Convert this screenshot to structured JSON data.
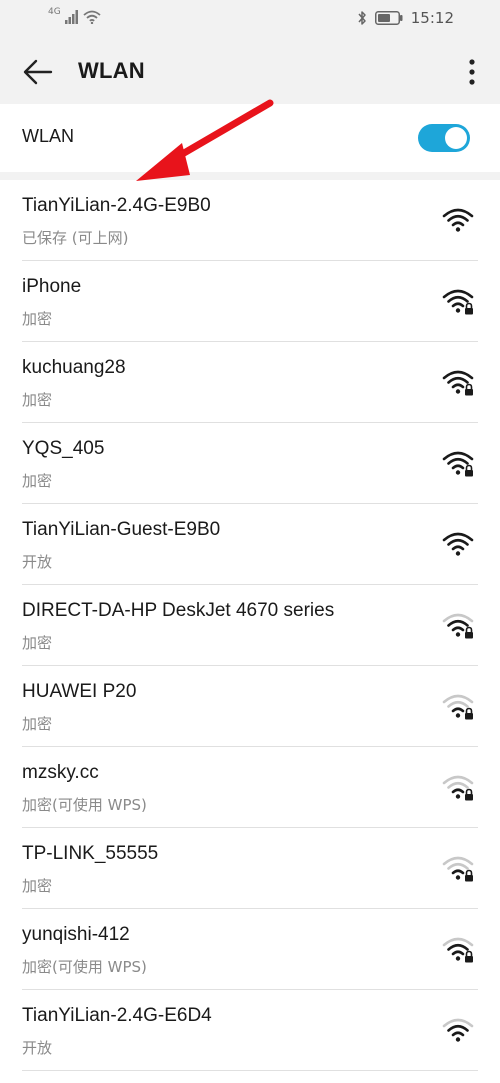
{
  "status_bar": {
    "signal_label": "4G",
    "time": "15:12"
  },
  "header": {
    "title": "WLAN"
  },
  "wlan_toggle": {
    "label": "WLAN",
    "on": true
  },
  "colors": {
    "accent": "#1ea6d9",
    "annotation": "#e8131b"
  },
  "networks": [
    {
      "name": "TianYiLian-2.4G-E9B0",
      "status": "已保存 (可上网)",
      "locked": false,
      "strength": 3
    },
    {
      "name": "iPhone",
      "status": "加密",
      "locked": true,
      "strength": 3
    },
    {
      "name": "kuchuang28",
      "status": "加密",
      "locked": true,
      "strength": 3
    },
    {
      "name": "YQS_405",
      "status": "加密",
      "locked": true,
      "strength": 3
    },
    {
      "name": "TianYiLian-Guest-E9B0",
      "status": "开放",
      "locked": false,
      "strength": 3
    },
    {
      "name": "DIRECT-DA-HP DeskJet 4670 series",
      "status": "加密",
      "locked": true,
      "strength": 2
    },
    {
      "name": "HUAWEI P20",
      "status": "加密",
      "locked": true,
      "strength": 1
    },
    {
      "name": "mzsky.cc",
      "status": "加密(可使用 WPS)",
      "locked": true,
      "strength": 1
    },
    {
      "name": "TP-LINK_55555",
      "status": "加密",
      "locked": true,
      "strength": 1
    },
    {
      "name": "yunqishi-412",
      "status": "加密(可使用 WPS)",
      "locked": true,
      "strength": 2
    },
    {
      "name": "TianYiLian-2.4G-E6D4",
      "status": "开放",
      "locked": false,
      "strength": 2
    }
  ]
}
